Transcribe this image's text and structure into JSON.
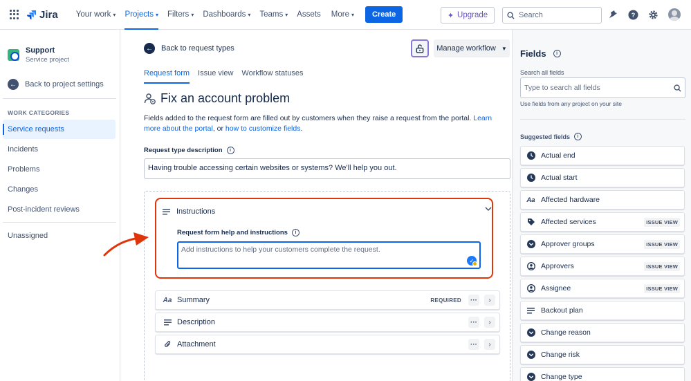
{
  "topnav": {
    "brand": "Jira",
    "items": [
      {
        "label": "Your work",
        "chevron": "▾",
        "active": false
      },
      {
        "label": "Projects",
        "chevron": "▾",
        "active": true
      },
      {
        "label": "Filters",
        "chevron": "▾",
        "active": false
      },
      {
        "label": "Dashboards",
        "chevron": "▾",
        "active": false
      },
      {
        "label": "Teams",
        "chevron": "▾",
        "active": false
      },
      {
        "label": "Assets",
        "chevron": "",
        "active": false
      },
      {
        "label": "More",
        "chevron": "▾",
        "active": false
      }
    ],
    "create_label": "Create",
    "upgrade_label": "Upgrade",
    "search_placeholder": "Search"
  },
  "sidebar": {
    "project_name": "Support",
    "project_type": "Service project",
    "back_label": "Back to project settings",
    "section_heading": "WORK CATEGORIES",
    "categories": [
      {
        "label": "Service requests",
        "selected": true
      },
      {
        "label": "Incidents",
        "selected": false
      },
      {
        "label": "Problems",
        "selected": false
      },
      {
        "label": "Changes",
        "selected": false
      },
      {
        "label": "Post-incident reviews",
        "selected": false
      }
    ],
    "unassigned_label": "Unassigned"
  },
  "main": {
    "back_label": "Back to request types",
    "manage_workflow_label": "Manage workflow",
    "tabs": [
      {
        "label": "Request form",
        "active": true
      },
      {
        "label": "Issue view",
        "active": false
      },
      {
        "label": "Workflow statuses",
        "active": false
      }
    ],
    "title": "Fix an account problem",
    "intro_text": "Fields added to the request form are filled out by customers when they raise a request from the portal. ",
    "intro_link1": "Learn more about the portal",
    "intro_mid": ", or ",
    "intro_link2": "how to customize fields",
    "intro_end": ".",
    "desc_label": "Request type description",
    "desc_value": "Having trouble accessing certain websites or systems? We'll help you out.",
    "instructions": {
      "title": "Instructions",
      "label": "Request form help and instructions",
      "placeholder": "Add instructions to help your customers complete the request."
    },
    "fields": [
      {
        "label": "Summary",
        "icon": "text-icon",
        "required_label": "REQUIRED"
      },
      {
        "label": "Description",
        "icon": "paragraph-icon",
        "required_label": ""
      },
      {
        "label": "Attachment",
        "icon": "attachment-icon",
        "required_label": ""
      }
    ]
  },
  "right_panel": {
    "title": "Fields",
    "search_label": "Search all fields",
    "search_placeholder": "Type to search all fields",
    "help_text": "Use fields from any project on your site",
    "suggested_heading": "Suggested fields",
    "suggested": [
      {
        "label": "Actual end",
        "icon": "clock-icon",
        "badge": ""
      },
      {
        "label": "Actual start",
        "icon": "clock-icon",
        "badge": ""
      },
      {
        "label": "Affected hardware",
        "icon": "text-icon",
        "badge": ""
      },
      {
        "label": "Affected services",
        "icon": "tag-icon",
        "badge": "ISSUE VIEW"
      },
      {
        "label": "Approver groups",
        "icon": "dropdown-icon",
        "badge": "ISSUE VIEW"
      },
      {
        "label": "Approvers",
        "icon": "person-icon",
        "badge": "ISSUE VIEW"
      },
      {
        "label": "Assignee",
        "icon": "person-icon",
        "badge": "ISSUE VIEW"
      },
      {
        "label": "Backout plan",
        "icon": "paragraph-icon",
        "badge": ""
      },
      {
        "label": "Change reason",
        "icon": "dropdown-icon",
        "badge": ""
      },
      {
        "label": "Change risk",
        "icon": "dropdown-icon",
        "badge": ""
      },
      {
        "label": "Change type",
        "icon": "dropdown-icon",
        "badge": ""
      }
    ]
  },
  "colors": {
    "brand_blue": "#0c66e4",
    "highlight_red": "#de350b",
    "upgrade_purple": "#6554c0"
  }
}
